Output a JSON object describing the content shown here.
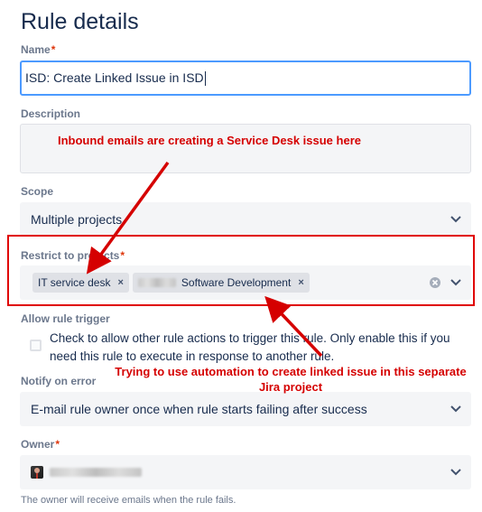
{
  "page": {
    "title": "Rule details"
  },
  "name_field": {
    "label": "Name",
    "required_mark": "*",
    "value": "ISD: Create Linked Issue in ISD"
  },
  "description": {
    "label": "Description",
    "value": ""
  },
  "scope": {
    "label": "Scope",
    "value": "Multiple projects"
  },
  "restrict": {
    "label": "Restrict to projects",
    "required_mark": "*",
    "chips": [
      {
        "label": "IT service desk",
        "remove": "×"
      },
      {
        "label": "Software Development",
        "remove": "×"
      }
    ],
    "highlight_color": "#e00000"
  },
  "rule_trigger": {
    "label": "Allow rule trigger",
    "checked": false,
    "text": "Check to allow other rule actions to trigger this rule. Only enable this if you need this rule to execute in response to another rule."
  },
  "notify": {
    "label": "Notify on error",
    "value": "E-mail rule owner once when rule starts failing after success"
  },
  "owner": {
    "label": "Owner",
    "required_mark": "*",
    "help": "The owner will receive emails when the rule fails."
  },
  "annotations": {
    "top": "Inbound emails are creating a Service Desk issue here",
    "bottom": "Trying to use automation to create linked issue in this separate Jira project",
    "color": "#d50000"
  },
  "icons": {
    "chevron": "chevron-down-icon",
    "clear": "clear-circle-icon",
    "remove": "close-icon"
  }
}
